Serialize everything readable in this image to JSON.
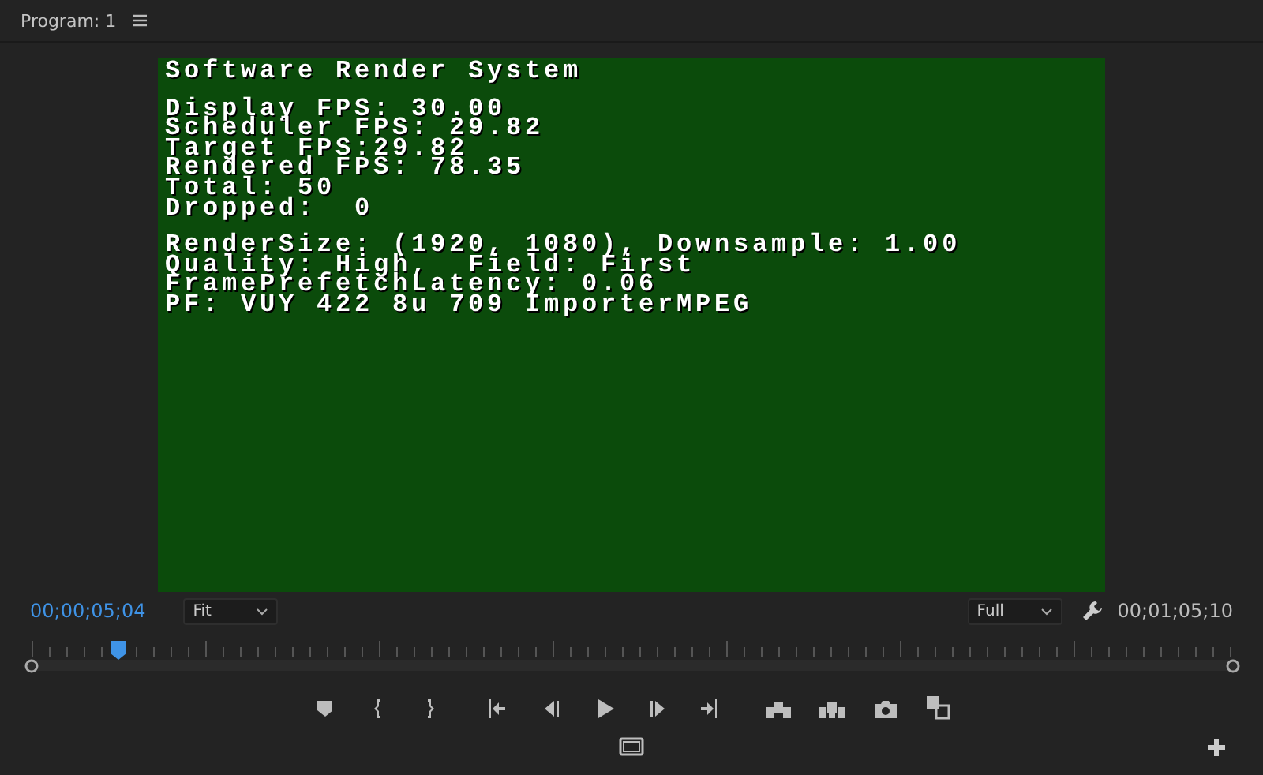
{
  "panel": {
    "title": "Program: 1"
  },
  "overlay": {
    "title": "Software Render System",
    "groups": [
      [
        "Display FPS: 30.00",
        "Scheduler FPS: 29.82",
        "Target FPS:29.82",
        "Rendered FPS: 78.35",
        "Total: 50",
        "Dropped:  0"
      ],
      [
        "RenderSize: (1920, 1080), Downsample: 1.00",
        "Quality: High,  Field: First",
        "FramePrefetchLatency: 0.06",
        "PF: VUY 422 8u 709 ImporterMPEG"
      ]
    ]
  },
  "timecode_current": "00;00;05;04",
  "zoom_select": {
    "value": "Fit"
  },
  "quality_select": {
    "value": "Full"
  },
  "timecode_duration": "00;01;05;10",
  "playhead": {
    "level": 0.072
  }
}
